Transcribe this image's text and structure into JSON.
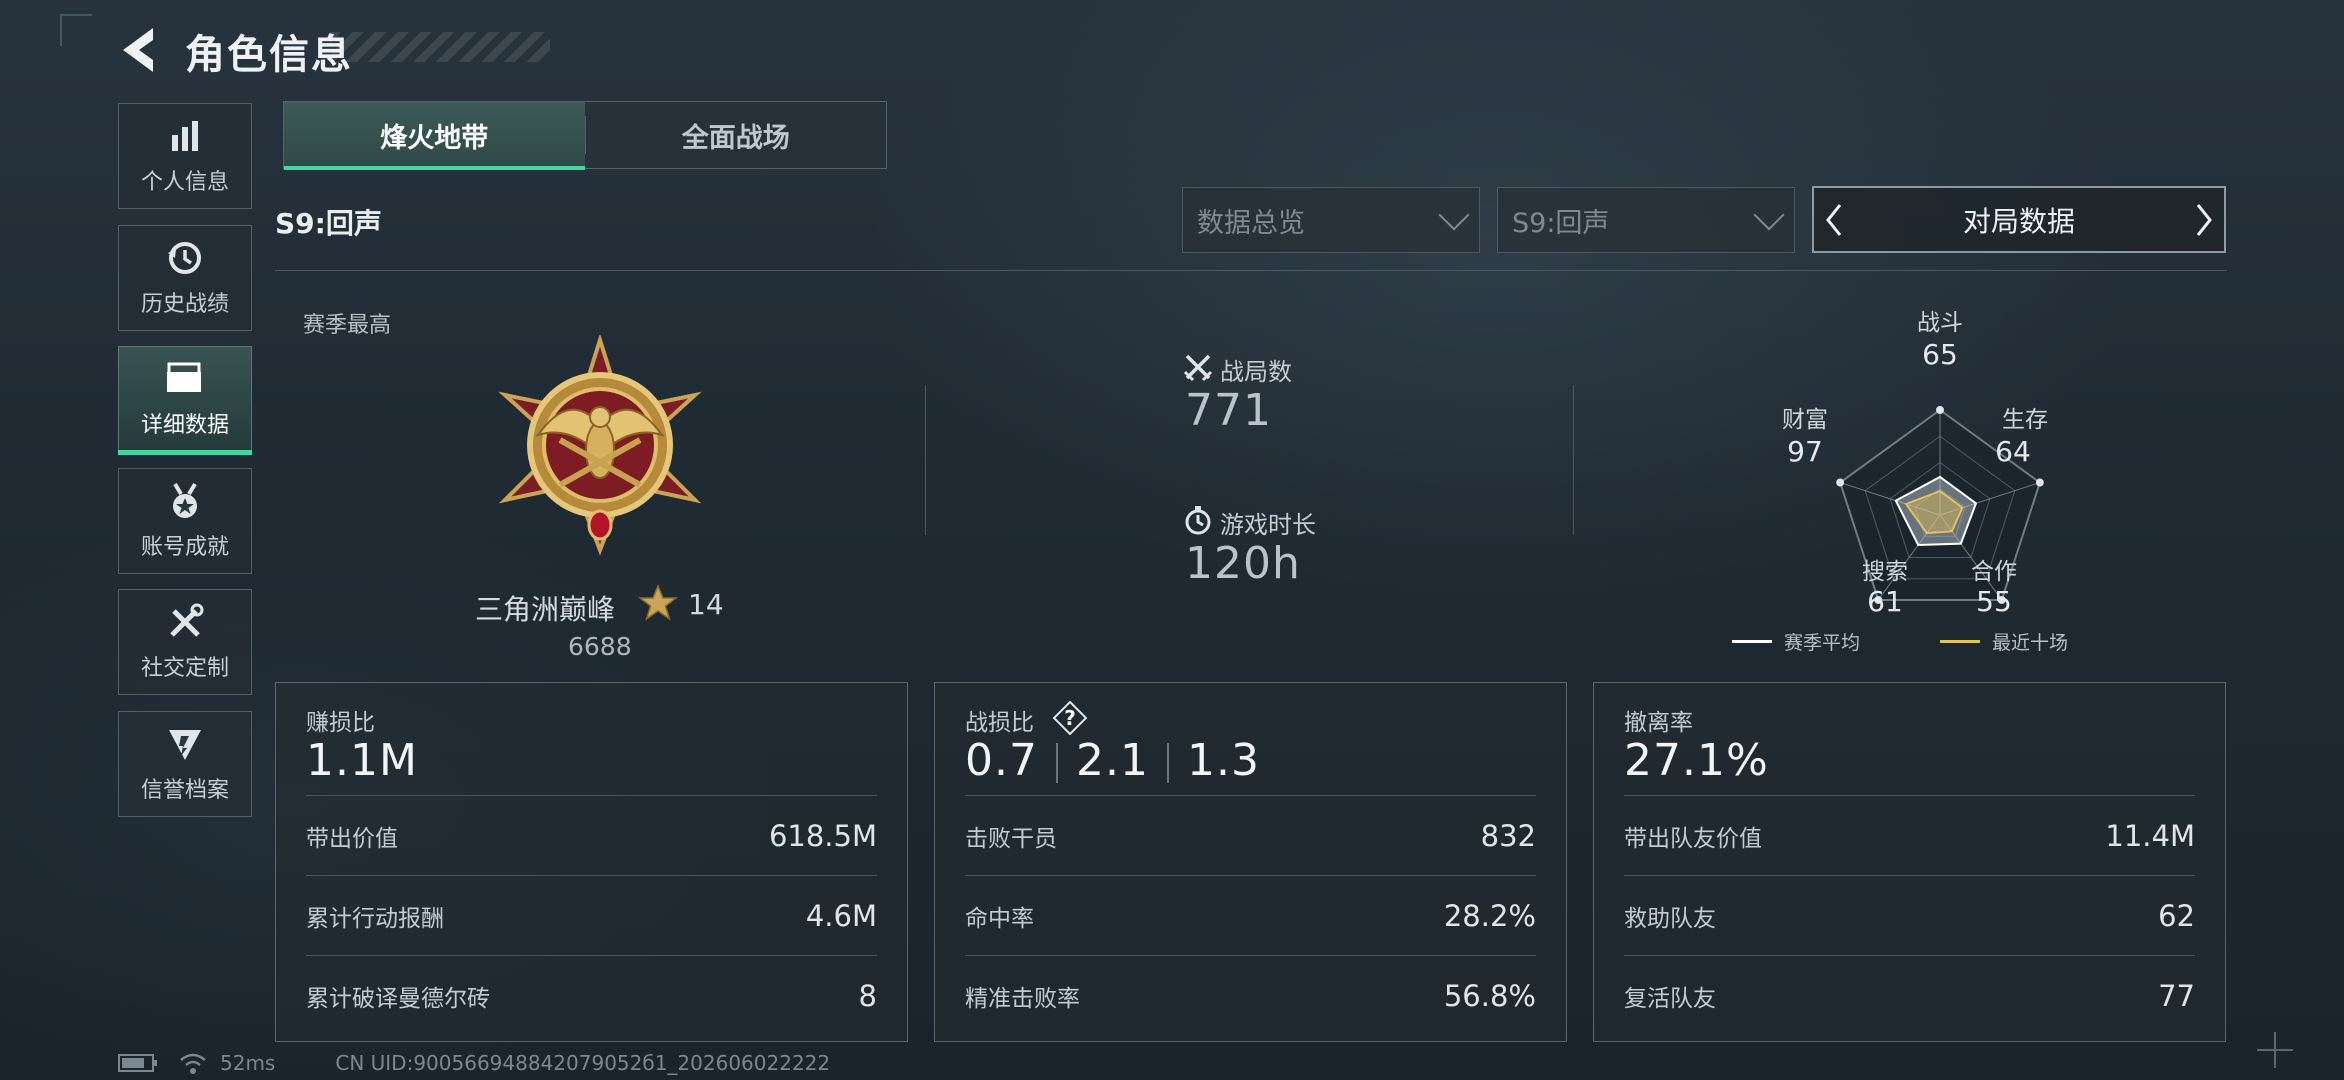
{
  "header": {
    "title": "角色信息"
  },
  "sidebar": {
    "items": [
      {
        "label": "个人信息",
        "icon": "bar-chart-icon"
      },
      {
        "label": "历史战绩",
        "icon": "history-icon"
      },
      {
        "label": "详细数据",
        "icon": "folder-icon",
        "active": true
      },
      {
        "label": "账号成就",
        "icon": "medal-icon"
      },
      {
        "label": "社交定制",
        "icon": "tools-icon"
      },
      {
        "label": "信誉档案",
        "icon": "shield-icon"
      }
    ]
  },
  "tabs": [
    {
      "label": "烽火地带",
      "active": true
    },
    {
      "label": "全面战场",
      "active": false
    }
  ],
  "season_label": "S9:回声",
  "filters": {
    "data_type": "数据总览",
    "season": "S9:回声",
    "view": "对局数据"
  },
  "overview": {
    "season_best_label": "赛季最高",
    "rank_name": "三角洲巅峰",
    "rank_stars": "14",
    "rank_score": "6688",
    "matches_label": "战局数",
    "matches_value": "771",
    "playtime_label": "游戏时长",
    "playtime_value": "120h"
  },
  "radar": {
    "axes": [
      {
        "label": "战斗",
        "value": "65"
      },
      {
        "label": "生存",
        "value": "64"
      },
      {
        "label": "合作",
        "value": "55"
      },
      {
        "label": "搜索",
        "value": "61"
      },
      {
        "label": "财富",
        "value": "97"
      }
    ],
    "legend": [
      {
        "label": "赛季平均",
        "color": "#ffffff"
      },
      {
        "label": "最近十场",
        "color": "#e3c25c"
      }
    ]
  },
  "panels": [
    {
      "title": "赚损比",
      "main": "1.1M",
      "rows": [
        {
          "label": "带出价值",
          "value": "618.5M"
        },
        {
          "label": "累计行动报酬",
          "value": "4.6M"
        },
        {
          "label": "累计破译曼德尔砖",
          "value": "8"
        }
      ]
    },
    {
      "title": "战损比",
      "main_parts": [
        "0.7",
        "2.1",
        "1.3"
      ],
      "help_glyph": "?",
      "rows": [
        {
          "label": "击败干员",
          "value": "832"
        },
        {
          "label": "命中率",
          "value": "28.2%"
        },
        {
          "label": "精准击败率",
          "value": "56.8%"
        }
      ]
    },
    {
      "title": "撤离率",
      "main": "27.1%",
      "rows": [
        {
          "label": "带出队友价值",
          "value": "11.4M"
        },
        {
          "label": "救助队友",
          "value": "62"
        },
        {
          "label": "复活队友",
          "value": "77"
        }
      ]
    }
  ],
  "footer": {
    "ping": "52ms",
    "uid": "CN UID:900566948842079052б1_202606022222"
  },
  "colors": {
    "accent": "#43d6a2",
    "gold": "#e3c25c"
  }
}
